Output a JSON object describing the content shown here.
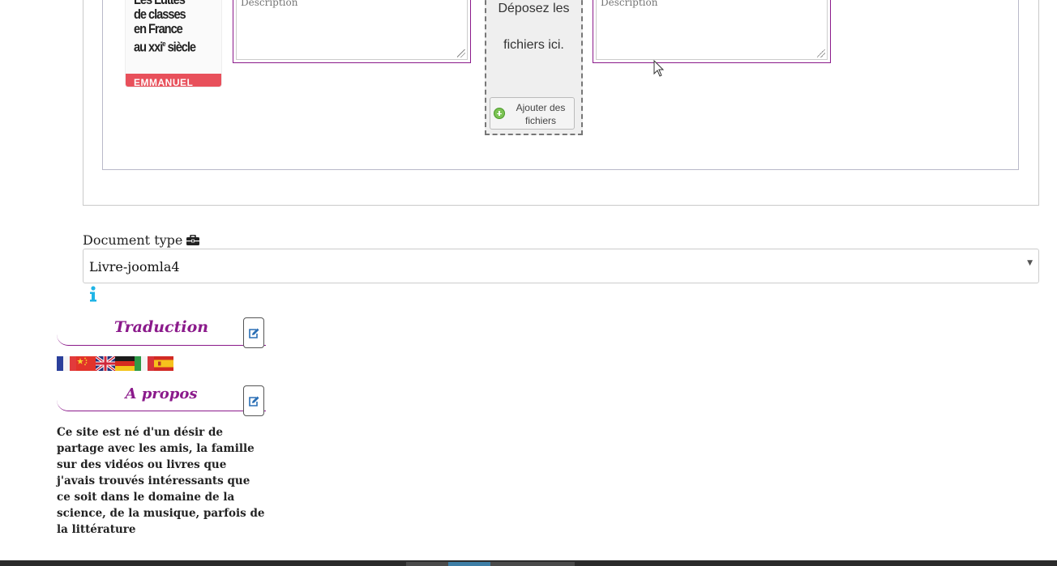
{
  "upload": {
    "book_cover_text": "Les Luttes de classes en France au XXIe siècle",
    "book_author": "EMMANUEL TODD",
    "description_placeholder_left": "Description",
    "description_placeholder_right": "Description",
    "drop_line1": "Déposez les",
    "drop_line2": "fichiers ici.",
    "add_files_label": "Ajouter des fichiers"
  },
  "document_type": {
    "label": "Document type",
    "selected": "Livre-joomla4"
  },
  "sidebar": {
    "traduction_title": "Traduction",
    "apropos_title": "A propos",
    "flags": [
      "fr",
      "cn",
      "gb",
      "de",
      "it",
      "es"
    ],
    "about_text": "Ce site est né d'un désir de partage avec les amis, la famille sur des vidéos ou livres que j'avais trouvés intéressants que ce soit dans le domaine de la science, de la musique, parfois de la littérature"
  },
  "colors": {
    "accent": "#8b1a8b",
    "info": "#1fb4e6",
    "edit_icon": "#2a6fb5"
  }
}
